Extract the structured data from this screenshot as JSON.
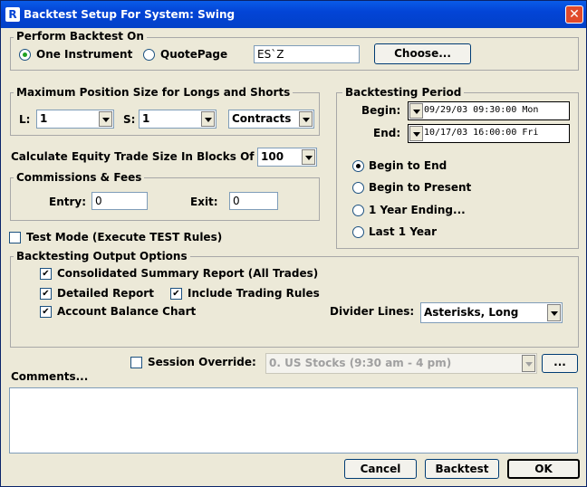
{
  "window": {
    "title": "Backtest Setup For System: Swing",
    "close_symbol": "✕",
    "app_icon": "R"
  },
  "perform": {
    "legend": "Perform Backtest On",
    "one_instrument": "One Instrument",
    "quotepage": "QuotePage",
    "symbol": "ES`Z",
    "choose": "Choose..."
  },
  "max_position": {
    "legend": "Maximum Position Size for Longs and Shorts",
    "l_label": "L:",
    "l_value": "1",
    "s_label": "S:",
    "s_value": "1",
    "unit": "Contracts"
  },
  "blocks": {
    "label": "Calculate Equity Trade Size In Blocks Of",
    "value": "100"
  },
  "commissions": {
    "legend": "Commissions & Fees",
    "entry_label": "Entry:",
    "entry_value": "0",
    "exit_label": "Exit:",
    "exit_value": "0"
  },
  "period": {
    "legend": "Backtesting Period",
    "begin_label": "Begin:",
    "begin_value": "09/29/03 09:30:00 Mon",
    "end_label": "End:",
    "end_value": "10/17/03 16:00:00 Fri",
    "options": [
      "Begin to End",
      "Begin to Present",
      "1 Year Ending...",
      "Last 1 Year"
    ]
  },
  "test_mode": {
    "label": "Test Mode (Execute TEST Rules)"
  },
  "output": {
    "legend": "Backtesting Output Options",
    "consolidated": "Consolidated Summary Report (All Trades)",
    "detailed": "Detailed Report",
    "include_rules": "Include Trading Rules",
    "balance_chart": "Account Balance Chart",
    "divider_label": "Divider Lines:",
    "divider_value": "Asterisks, Long",
    "check_symbol": "✔"
  },
  "session": {
    "label": "Session Override:",
    "value": "0. US Stocks (9:30 am - 4 pm)",
    "more": "..."
  },
  "comments": {
    "label": "Comments..."
  },
  "buttons": {
    "cancel": "Cancel",
    "backtest": "Backtest",
    "ok": "OK"
  },
  "colors": {
    "titlebar": "#0344d6",
    "dialog_bg": "#ece9d8",
    "radio_dot": "#21a121"
  }
}
